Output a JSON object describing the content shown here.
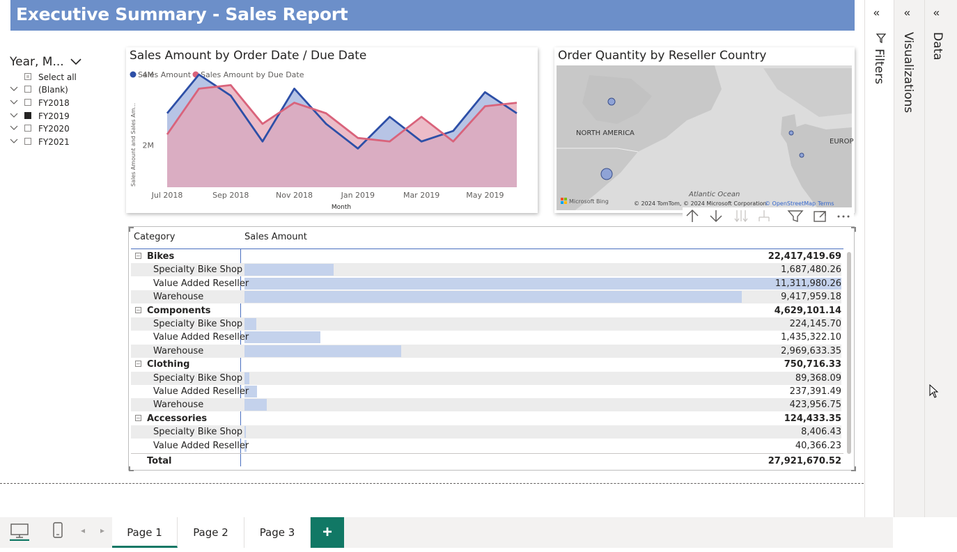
{
  "report": {
    "title": "Executive Summary - Sales Report"
  },
  "slicer": {
    "title": "Year, M...",
    "items": [
      {
        "label": "Select all",
        "state": "partial",
        "expandable": false
      },
      {
        "label": "(Blank)",
        "state": "unchecked",
        "expandable": true
      },
      {
        "label": "FY2018",
        "state": "unchecked",
        "expandable": true
      },
      {
        "label": "FY2019",
        "state": "checked",
        "expandable": true
      },
      {
        "label": "FY2020",
        "state": "unchecked",
        "expandable": true
      },
      {
        "label": "FY2021",
        "state": "unchecked",
        "expandable": true
      }
    ]
  },
  "line_chart": {
    "title": "Sales Amount by Order Date / Due Date",
    "legend": [
      "Sales Amount",
      "Sales Amount by Due Date"
    ],
    "xlabel": "Month",
    "ylabel": "Sales Amount and Sales Am...",
    "yticks": [
      "4M",
      "2M"
    ],
    "xticks": [
      "Jul 2018",
      "Sep 2018",
      "Nov 2018",
      "Jan 2019",
      "Mar 2019",
      "May 2019"
    ]
  },
  "chart_data": {
    "type": "area",
    "title": "Sales Amount by Order Date / Due Date",
    "xlabel": "Month",
    "ylabel": "Sales Amount and Sales Am...",
    "ylim": [
      0.8,
      4.2
    ],
    "y_unit": "M",
    "categories": [
      "Jul 2018",
      "Aug 2018",
      "Sep 2018",
      "Oct 2018",
      "Nov 2018",
      "Dec 2018",
      "Jan 2019",
      "Feb 2019",
      "Mar 2019",
      "Apr 2019",
      "May 2019",
      "Jun 2019"
    ],
    "series": [
      {
        "name": "Sales Amount",
        "color": "#2d4fa7",
        "values": [
          2.9,
          4.0,
          3.4,
          2.1,
          3.6,
          2.6,
          1.9,
          2.8,
          2.1,
          2.4,
          3.5,
          2.9
        ]
      },
      {
        "name": "Sales Amount by Due Date",
        "color": "#d9637b",
        "values": [
          2.3,
          3.6,
          3.7,
          2.6,
          3.2,
          2.9,
          2.2,
          2.1,
          2.8,
          2.1,
          3.1,
          3.2
        ]
      }
    ]
  },
  "map": {
    "title": "Order Quantity by Reseller Country",
    "labels": {
      "north_america": "NORTH AMERICA",
      "europe": "EUROP",
      "ocean": "Atlantic Ocean"
    },
    "attribution": "© 2024 TomTom, © 2024 Microsoft Corporation",
    "osm": "© OpenStreetMap",
    "terms": "Terms",
    "brand": "Microsoft Bing",
    "bubble_color": "#8fa3d6"
  },
  "table": {
    "headers": {
      "category": "Category",
      "amount": "Sales Amount"
    },
    "groups": [
      {
        "name": "Bikes",
        "total": "22,417,419.69",
        "rows": [
          {
            "label": "Specialty Bike Shop",
            "value": "1,687,480.26",
            "fraction": 0.149
          },
          {
            "label": "Value Added Reseller",
            "value": "11,311,980.26",
            "fraction": 1.0
          },
          {
            "label": "Warehouse",
            "value": "9,417,959.18",
            "fraction": 0.833
          }
        ]
      },
      {
        "name": "Components",
        "total": "4,629,101.14",
        "rows": [
          {
            "label": "Specialty Bike Shop",
            "value": "224,145.70",
            "fraction": 0.02
          },
          {
            "label": "Value Added Reseller",
            "value": "1,435,322.10",
            "fraction": 0.127
          },
          {
            "label": "Warehouse",
            "value": "2,969,633.35",
            "fraction": 0.263
          }
        ]
      },
      {
        "name": "Clothing",
        "total": "750,716.33",
        "rows": [
          {
            "label": "Specialty Bike Shop",
            "value": "89,368.09",
            "fraction": 0.008
          },
          {
            "label": "Value Added Reseller",
            "value": "237,391.49",
            "fraction": 0.021
          },
          {
            "label": "Warehouse",
            "value": "423,956.75",
            "fraction": 0.037
          }
        ]
      },
      {
        "name": "Accessories",
        "total": "124,433.35",
        "rows": [
          {
            "label": "Specialty Bike Shop",
            "value": "8,406.43",
            "fraction": 0.001
          },
          {
            "label": "Value Added Reseller",
            "value": "40,366.23",
            "fraction": 0.004
          }
        ]
      }
    ],
    "total_label": "Total",
    "total_value": "27,921,670.52"
  },
  "panes": {
    "filters": "Filters",
    "visualizations": "Visualizations",
    "data": "Data"
  },
  "pages": {
    "tabs": [
      "Page 1",
      "Page 2",
      "Page 3"
    ],
    "active": "Page 1",
    "add": "+"
  },
  "colors": {
    "banner": "#6c8fc9",
    "accent": "#117865",
    "bar": "#c4d2ec"
  }
}
